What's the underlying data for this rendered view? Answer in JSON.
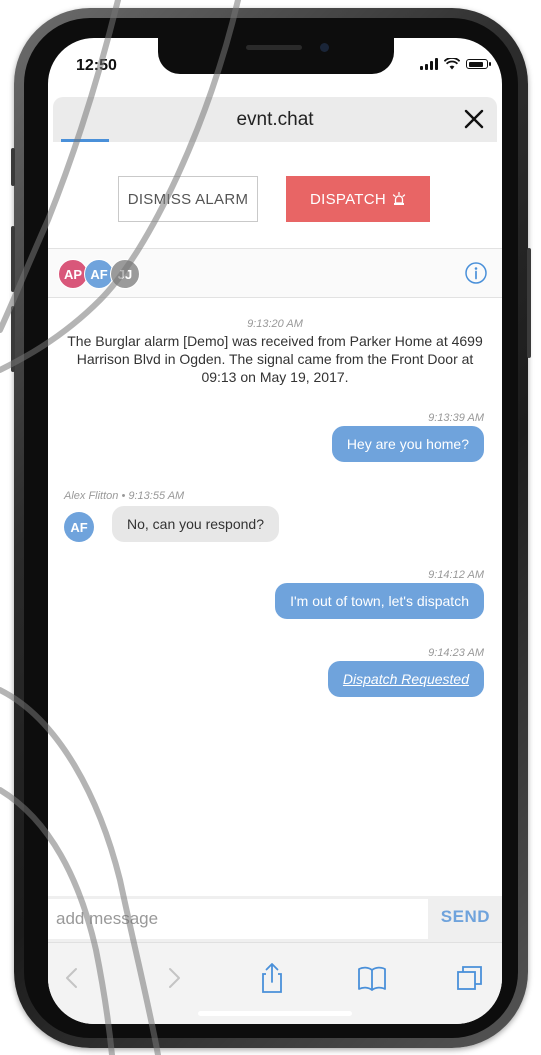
{
  "status_bar": {
    "time": "12:50"
  },
  "header": {
    "title": "evnt.chat"
  },
  "actions": {
    "dismiss_label": "DISMISS ALARM",
    "dispatch_label": "DISPATCH"
  },
  "participants": [
    {
      "initials": "AP",
      "color": "#d9577a"
    },
    {
      "initials": "AF",
      "color": "#6fa3dc"
    },
    {
      "initials": "JJ",
      "color": "#9a9a9a"
    }
  ],
  "messages": {
    "system": {
      "time": "9:13:20 AM",
      "text": "The Burglar alarm [Demo] was received from Parker Home at 4699 Harrison Blvd  in Ogden. The signal came from the Front Door at 09:13 on May 19, 2017."
    },
    "m1": {
      "time": "9:13:39 AM",
      "text": "Hey are you home?"
    },
    "m2": {
      "meta": "Alex Flitton • 9:13:55 AM",
      "avatar": "AF",
      "text": "No, can you respond?"
    },
    "m3": {
      "time": "9:14:12 AM",
      "text": "I'm out of town, let's dispatch"
    },
    "m4": {
      "time": "9:14:23 AM",
      "text": "Dispatch Requested"
    }
  },
  "composer": {
    "placeholder": "add message",
    "send_label": "SEND"
  },
  "colors": {
    "accent": "#6fa3dc",
    "dispatch": "#e86565",
    "incoming_bubble": "#e7e7e7"
  },
  "icons": [
    "close-icon",
    "alarm-icon",
    "info-icon",
    "back-icon",
    "forward-icon",
    "share-icon",
    "bookmarks-icon",
    "tabs-icon"
  ]
}
